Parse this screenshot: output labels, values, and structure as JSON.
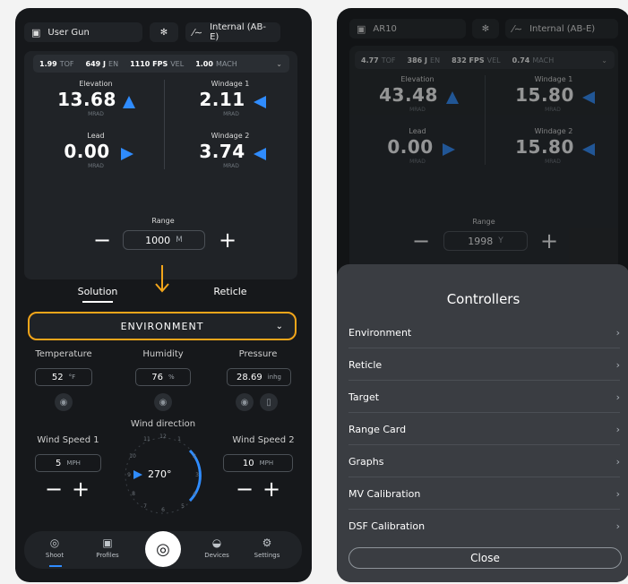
{
  "left": {
    "header": {
      "profile_icon": "id-card-icon",
      "profile_name": "User Gun",
      "bluetooth_icon": "bluetooth-icon",
      "device_icon": "wind-gauge-icon",
      "device_name": "Internal (AB-E)"
    },
    "stats": [
      {
        "value": "1.99",
        "unit": "TOF"
      },
      {
        "value": "649 J",
        "unit": "EN"
      },
      {
        "value": "1110 FPS",
        "unit": "VEL"
      },
      {
        "value": "1.00",
        "unit": "MACH"
      }
    ],
    "elevation": {
      "label": "Elevation",
      "value": "13.68",
      "unit": "MRAD"
    },
    "windage1": {
      "label": "Windage 1",
      "value": "2.11",
      "unit": "MRAD"
    },
    "lead": {
      "label": "Lead",
      "value": "0.00",
      "unit": "MRAD"
    },
    "windage2": {
      "label": "Windage 2",
      "value": "3.74",
      "unit": "MRAD"
    },
    "range": {
      "label": "Range",
      "value": "1000",
      "unit": "M"
    },
    "tabs": {
      "solution": "Solution",
      "reticle": "Reticle"
    },
    "environment_label": "ENVIRONMENT",
    "temperature": {
      "label": "Temperature",
      "value": "52",
      "unit": "°F"
    },
    "humidity": {
      "label": "Humidity",
      "value": "76",
      "unit": "%"
    },
    "pressure": {
      "label": "Pressure",
      "value": "28.69",
      "unit": "inhg"
    },
    "wind_direction": {
      "label": "Wind direction",
      "value": "270°"
    },
    "wind_speed1": {
      "label": "Wind Speed 1",
      "value": "5",
      "unit": "MPH"
    },
    "wind_speed2": {
      "label": "Wind Speed 2",
      "value": "10",
      "unit": "MPH"
    },
    "clock": [
      "12",
      "1",
      "2",
      "3",
      "4",
      "5",
      "6",
      "7",
      "8",
      "9",
      "10",
      "11"
    ],
    "nav": [
      {
        "label": "Shoot",
        "icon": "crosshair-icon"
      },
      {
        "label": "Profiles",
        "icon": "id-card-icon"
      },
      {
        "label": "Devices",
        "icon": "device-icon"
      },
      {
        "label": "Settings",
        "icon": "gear-icon"
      }
    ]
  },
  "right": {
    "header": {
      "profile_name": "AR10",
      "device_name": "Internal (AB-E)"
    },
    "stats": [
      {
        "value": "4.77",
        "unit": "TOF"
      },
      {
        "value": "386 J",
        "unit": "EN"
      },
      {
        "value": "832 FPS",
        "unit": "VEL"
      },
      {
        "value": "0.74",
        "unit": "MACH"
      }
    ],
    "elevation": {
      "label": "Elevation",
      "value": "43.48",
      "unit": "MRAD"
    },
    "windage1": {
      "label": "Windage 1",
      "value": "15.80",
      "unit": "MRAD"
    },
    "lead": {
      "label": "Lead",
      "value": "0.00",
      "unit": "MRAD"
    },
    "windage2": {
      "label": "Windage 2",
      "value": "15.80",
      "unit": "MRAD"
    },
    "range": {
      "label": "Range",
      "value": "1998",
      "unit": "Y"
    },
    "sheet": {
      "title": "Controllers",
      "items": [
        "Environment",
        "Reticle",
        "Target",
        "Range Card",
        "Graphs",
        "MV Calibration",
        "DSF Calibration"
      ],
      "close_label": "Close"
    }
  },
  "colors": {
    "accent_blue": "#2f8cff",
    "highlight_orange": "#f2a51a"
  }
}
